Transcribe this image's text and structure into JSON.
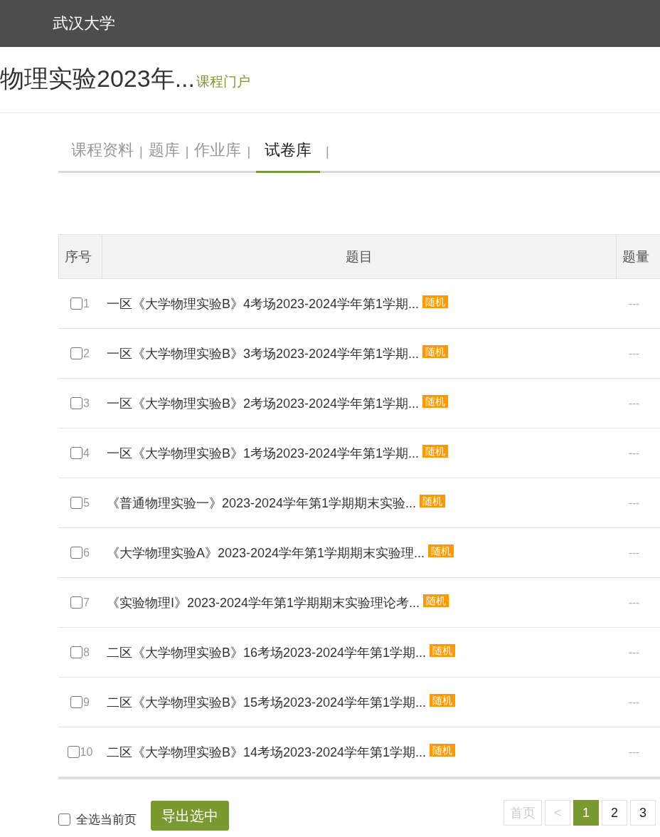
{
  "header": {
    "title": "武汉大学"
  },
  "course": {
    "title": "物理实验2023年...",
    "portal_link": "课程门户"
  },
  "tabs": [
    {
      "label": "课程资料",
      "selected": false,
      "separator": "|"
    },
    {
      "label": "题库",
      "selected": false,
      "separator": "|"
    },
    {
      "label": "作业库",
      "selected": false,
      "separator": "|"
    },
    {
      "label": "试卷库",
      "selected": true,
      "separator": "|"
    }
  ],
  "table": {
    "columns": [
      "序号",
      "题目",
      "题量"
    ],
    "rows": [
      {
        "index": "1",
        "checked": false,
        "title": "一区《大学物理实验B》4考场2023-2024学年第1学期...",
        "badge": "随机",
        "count": "---"
      },
      {
        "index": "2",
        "checked": false,
        "title": "一区《大学物理实验B》3考场2023-2024学年第1学期...",
        "badge": "随机",
        "count": "---"
      },
      {
        "index": "3",
        "checked": false,
        "title": "一区《大学物理实验B》2考场2023-2024学年第1学期...",
        "badge": "随机",
        "count": "---"
      },
      {
        "index": "4",
        "checked": false,
        "title": "一区《大学物理实验B》1考场2023-2024学年第1学期...",
        "badge": "随机",
        "count": "---"
      },
      {
        "index": "5",
        "checked": false,
        "title": "《普通物理实验一》2023-2024学年第1学期期末实验...",
        "badge": "随机",
        "count": "---"
      },
      {
        "index": "6",
        "checked": false,
        "title": "《大学物理实验A》2023-2024学年第1学期期末实验理...",
        "badge": "随机",
        "count": "---"
      },
      {
        "index": "7",
        "checked": false,
        "title": "《实验物理I》2023-2024学年第1学期期末实验理论考...",
        "badge": "随机",
        "count": "---"
      },
      {
        "index": "8",
        "checked": false,
        "title": "二区《大学物理实验B》16考场2023-2024学年第1学期...",
        "badge": "随机",
        "count": "---"
      },
      {
        "index": "9",
        "checked": false,
        "title": "二区《大学物理实验B》15考场2023-2024学年第1学期...",
        "badge": "随机",
        "count": "---"
      },
      {
        "index": "10",
        "checked": false,
        "title": "二区《大学物理实验B》14考场2023-2024学年第1学期...",
        "badge": "随机",
        "count": "---"
      }
    ]
  },
  "footer": {
    "select_all": {
      "label": "全选当前页",
      "checked": false
    },
    "export_button": "导出选中"
  },
  "pagination": [
    {
      "label": "首页",
      "disabled": true,
      "selected": false
    },
    {
      "label": "<",
      "disabled": true,
      "selected": false
    },
    {
      "label": "1",
      "disabled": false,
      "selected": true
    },
    {
      "label": "2",
      "disabled": false,
      "selected": false
    },
    {
      "label": "3",
      "disabled": false,
      "selected": false
    }
  ]
}
